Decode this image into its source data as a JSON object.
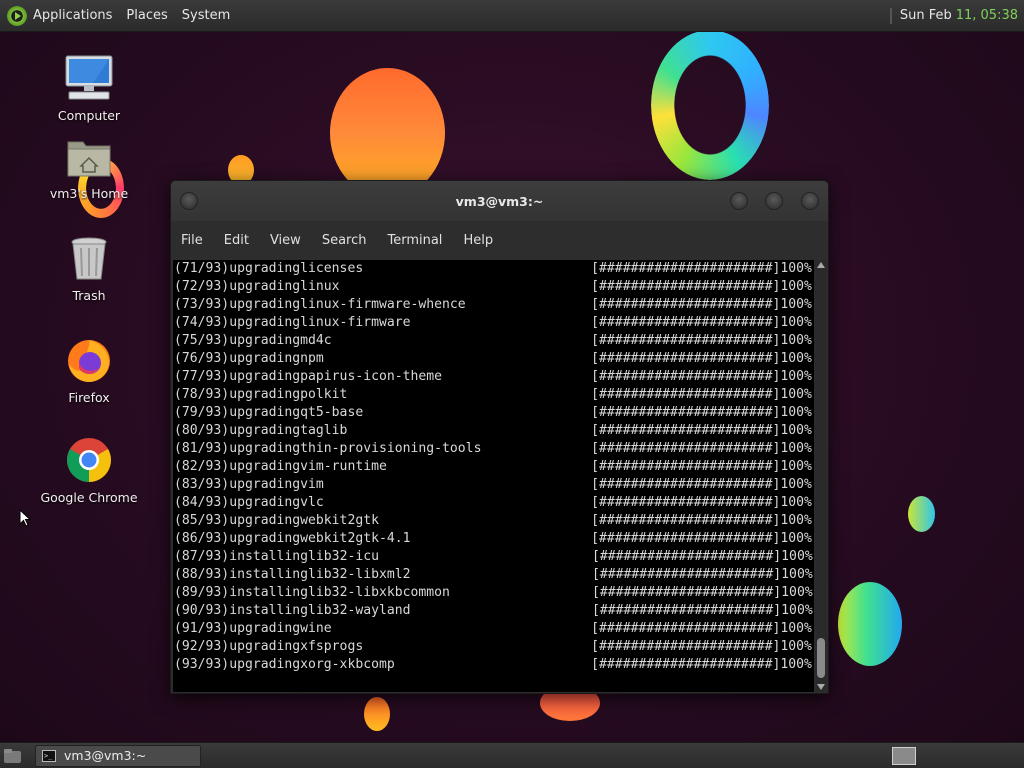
{
  "top_panel": {
    "menus": [
      "Applications",
      "Places",
      "System"
    ],
    "clock_prefix": "Sun Feb",
    "clock_time": "11, 05:38"
  },
  "desktop_icons": {
    "computer": "Computer",
    "home": "vm3's Home",
    "trash": "Trash",
    "firefox": "Firefox",
    "chrome": "Google Chrome"
  },
  "terminal": {
    "title": "vm3@vm3:~",
    "menu": [
      "File",
      "Edit",
      "View",
      "Search",
      "Terminal",
      "Help"
    ],
    "progress_bar": "[######################]",
    "percent": "100%",
    "lines": [
      {
        "num": "(71/93)",
        "action": "upgrading",
        "pkg": "licenses"
      },
      {
        "num": "(72/93)",
        "action": "upgrading",
        "pkg": "linux"
      },
      {
        "num": "(73/93)",
        "action": "upgrading",
        "pkg": "linux-firmware-whence"
      },
      {
        "num": "(74/93)",
        "action": "upgrading",
        "pkg": "linux-firmware"
      },
      {
        "num": "(75/93)",
        "action": "upgrading",
        "pkg": "md4c"
      },
      {
        "num": "(76/93)",
        "action": "upgrading",
        "pkg": "npm"
      },
      {
        "num": "(77/93)",
        "action": "upgrading",
        "pkg": "papirus-icon-theme"
      },
      {
        "num": "(78/93)",
        "action": "upgrading",
        "pkg": "polkit"
      },
      {
        "num": "(79/93)",
        "action": "upgrading",
        "pkg": "qt5-base"
      },
      {
        "num": "(80/93)",
        "action": "upgrading",
        "pkg": "taglib"
      },
      {
        "num": "(81/93)",
        "action": "upgrading",
        "pkg": "thin-provisioning-tools"
      },
      {
        "num": "(82/93)",
        "action": "upgrading",
        "pkg": "vim-runtime"
      },
      {
        "num": "(83/93)",
        "action": "upgrading",
        "pkg": "vim"
      },
      {
        "num": "(84/93)",
        "action": "upgrading",
        "pkg": "vlc"
      },
      {
        "num": "(85/93)",
        "action": "upgrading",
        "pkg": "webkit2gtk"
      },
      {
        "num": "(86/93)",
        "action": "upgrading",
        "pkg": "webkit2gtk-4.1"
      },
      {
        "num": "(87/93)",
        "action": "installing",
        "pkg": "lib32-icu"
      },
      {
        "num": "(88/93)",
        "action": "installing",
        "pkg": "lib32-libxml2"
      },
      {
        "num": "(89/93)",
        "action": "installing",
        "pkg": "lib32-libxkbcommon"
      },
      {
        "num": "(90/93)",
        "action": "installing",
        "pkg": "lib32-wayland"
      },
      {
        "num": "(91/93)",
        "action": "upgrading",
        "pkg": "wine"
      },
      {
        "num": "(92/93)",
        "action": "upgrading",
        "pkg": "xfsprogs"
      },
      {
        "num": "(93/93)",
        "action": "upgrading",
        "pkg": "xorg-xkbcomp"
      }
    ]
  },
  "taskbar": {
    "terminal_task": "vm3@vm3:~"
  },
  "colors": {
    "desktop_bg": "#2a0c23",
    "panel_bg": "#2b2b2b",
    "clock_accent": "#7fd05a",
    "terminal_bg": "#000000",
    "terminal_fg": "#d8d8d8"
  }
}
